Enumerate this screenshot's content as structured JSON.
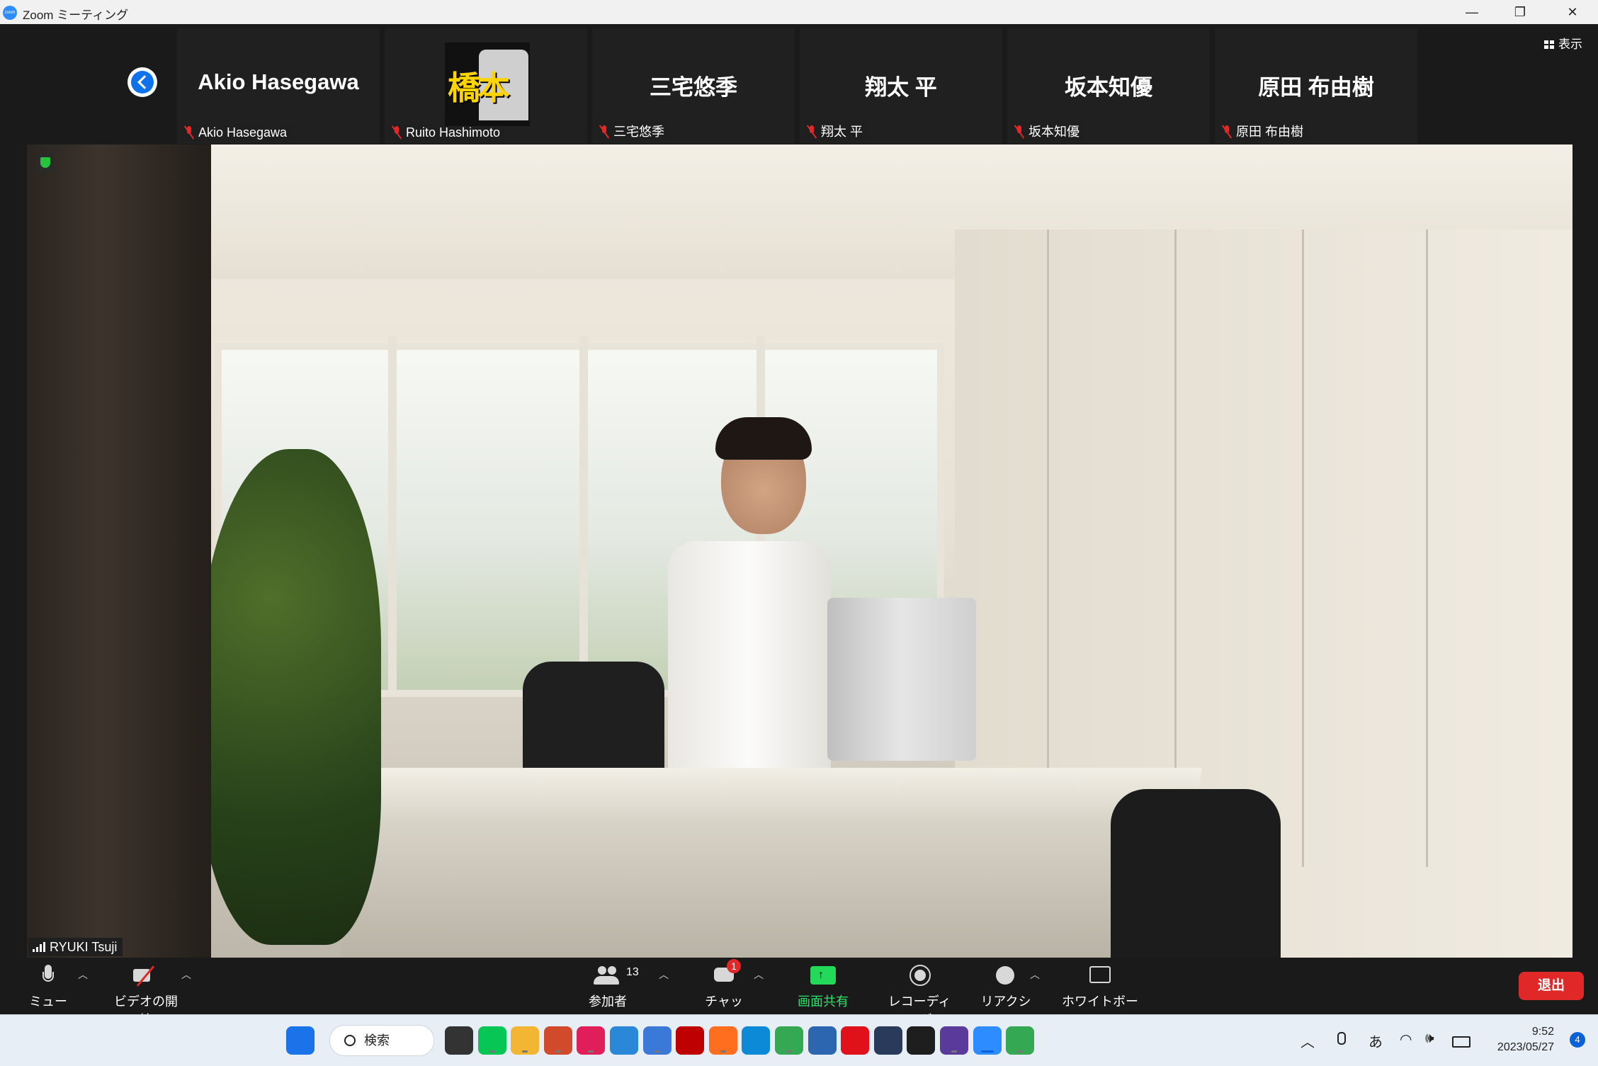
{
  "window": {
    "app_icon_text": "zoom",
    "title": "Zoom ミーティング",
    "minimize": "—",
    "restore": "❐",
    "close": "✕"
  },
  "gallery": {
    "view_label": "表示",
    "participants": [
      {
        "display": "Akio Hasegawa",
        "name": "Akio Hasegawa"
      },
      {
        "display": "",
        "name": "Ruito Hashimoto",
        "avatar_text": "橋本"
      },
      {
        "display": "三宅悠季",
        "name": "三宅悠季"
      },
      {
        "display": "翔太 平",
        "name": "翔太 平"
      },
      {
        "display": "坂本知優",
        "name": "坂本知優"
      },
      {
        "display": "原田 布由樹",
        "name": "原田 布由樹"
      }
    ]
  },
  "video": {
    "speaker_name": "RYUKI Tsuji"
  },
  "toolbar": {
    "mute": "ミュート",
    "video": "ビデオの開始",
    "participants": "参加者",
    "participant_count": "13",
    "chat": "チャット",
    "chat_badge": "1",
    "share": "画面共有",
    "record": "レコーディング",
    "reactions": "リアクション",
    "whiteboard": "ホワイトボード",
    "leave": "退出"
  },
  "taskbar": {
    "search": "検索",
    "ime": "あ",
    "time": "9:52",
    "date": "2023/05/27",
    "notifications": "4",
    "apps": [
      {
        "name": "windows-start",
        "color": "#1a73e8"
      },
      {
        "name": "task-view",
        "color": "#333333"
      },
      {
        "name": "line",
        "color": "#06c755"
      },
      {
        "name": "file-explorer",
        "color": "#f2b632"
      },
      {
        "name": "photo-app",
        "color": "#d04a2b"
      },
      {
        "name": "slack",
        "color": "#e01e5a"
      },
      {
        "name": "paint",
        "color": "#2b88d8"
      },
      {
        "name": "notepad",
        "color": "#3a79d8"
      },
      {
        "name": "filezilla",
        "color": "#bf0000"
      },
      {
        "name": "firefox",
        "color": "#ff6d1f"
      },
      {
        "name": "edge",
        "color": "#0c8ad8"
      },
      {
        "name": "chrome",
        "color": "#34a853"
      },
      {
        "name": "chat-app",
        "color": "#2d66b0"
      },
      {
        "name": "opera",
        "color": "#e0111b"
      },
      {
        "name": "app-dark",
        "color": "#2a3a5a"
      },
      {
        "name": "app-hex",
        "color": "#1e1e1e"
      },
      {
        "name": "app-3d",
        "color": "#5a3a9a"
      },
      {
        "name": "zoom",
        "color": "#2d8cff"
      },
      {
        "name": "chrome-2",
        "color": "#34a853"
      }
    ]
  }
}
